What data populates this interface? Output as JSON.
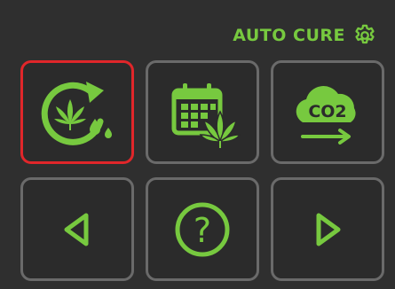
{
  "header": {
    "title": "AUTO CURE",
    "settings_icon": "gear-icon"
  },
  "colors": {
    "background": "#2f2f2f",
    "accent": "#77c93f",
    "tile_border": "#6a6a6a",
    "selected_border": "#e0262a"
  },
  "tiles": [
    {
      "id": "auto-cure-cycle",
      "icon": "cure-cycle-icon",
      "selected": true
    },
    {
      "id": "schedule",
      "icon": "calendar-leaf-icon",
      "selected": false
    },
    {
      "id": "co2",
      "icon": "co2-cloud-icon",
      "label": "CO2",
      "selected": false
    },
    {
      "id": "back",
      "icon": "triangle-left-icon",
      "selected": false
    },
    {
      "id": "help",
      "icon": "help-icon",
      "label": "?",
      "selected": false
    },
    {
      "id": "forward",
      "icon": "triangle-right-icon",
      "selected": false
    }
  ]
}
